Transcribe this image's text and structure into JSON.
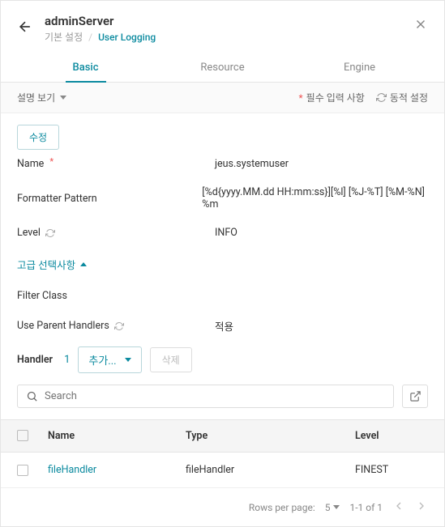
{
  "header": {
    "title": "adminServer",
    "breadcrumb_root": "기본 설정",
    "breadcrumb_current": "User Logging"
  },
  "tabs": {
    "basic": "Basic",
    "resource": "Resource",
    "engine": "Engine"
  },
  "subbar": {
    "view_toggle": "설명 보기",
    "required_legend": "필수 입력 사항",
    "dynamic_legend": "동적 설정"
  },
  "actions": {
    "edit": "수정"
  },
  "fields": {
    "name_label": "Name",
    "name_value": "jeus.systemuser",
    "formatter_label": "Formatter Pattern",
    "formatter_value": "[%d{yyyy.MM.dd HH:mm:ss}][%l] [%J-%T] [%M-%N] %m",
    "level_label": "Level",
    "level_value": "INFO",
    "filter_label": "Filter Class",
    "filter_value": "",
    "parent_label": "Use Parent Handlers",
    "parent_value": "적용"
  },
  "advanced": {
    "label": "고급 선택사항"
  },
  "handler": {
    "label": "Handler",
    "count": "1",
    "add": "추가...",
    "delete": "삭제"
  },
  "search": {
    "placeholder": "Search"
  },
  "table": {
    "headers": {
      "name": "Name",
      "type": "Type",
      "level": "Level"
    },
    "rows": [
      {
        "name": "fileHandler",
        "type": "fileHandler",
        "level": "FINEST"
      }
    ]
  },
  "pager": {
    "rows_label": "Rows per page:",
    "page_size": "5",
    "range": "1-1 of 1"
  }
}
